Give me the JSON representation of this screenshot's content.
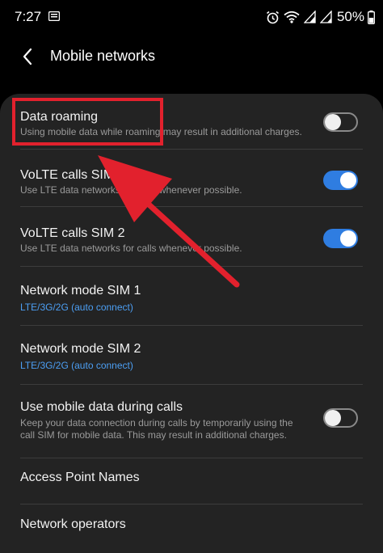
{
  "status_bar": {
    "time": "7:27",
    "battery": "50%",
    "icons": [
      "notification-icon",
      "alarm-icon",
      "wifi-icon",
      "signal-icon",
      "signal-icon",
      "battery-icon"
    ]
  },
  "header": {
    "title": "Mobile networks",
    "back_icon": "chevron-left-icon"
  },
  "settings": [
    {
      "title": "Data roaming",
      "subtitle": "Using mobile data while roaming may result in additional charges.",
      "toggle": "off"
    },
    {
      "title": "VoLTE calls SIM 1",
      "subtitle": "Use LTE data networks for calls whenever possible.",
      "toggle": "on"
    },
    {
      "title": "VoLTE calls SIM 2",
      "subtitle": "Use LTE data networks for calls whenever possible.",
      "toggle": "on"
    },
    {
      "title": "Network mode SIM 1",
      "subtitle": "LTE/3G/2G (auto connect)"
    },
    {
      "title": "Network mode SIM 2",
      "subtitle": "LTE/3G/2G (auto connect)"
    },
    {
      "title": "Use mobile data during calls",
      "subtitle": "Keep your data connection during calls by temporarily using the call SIM for mobile data. This may result in additional charges.",
      "toggle": "off"
    },
    {
      "title": "Access Point Names"
    },
    {
      "title": "Network operators"
    }
  ],
  "colors": {
    "accent": "#4c9ff4",
    "toggle_on": "#2f7de1",
    "annotation": "#e2212d",
    "panel": "#232323"
  }
}
